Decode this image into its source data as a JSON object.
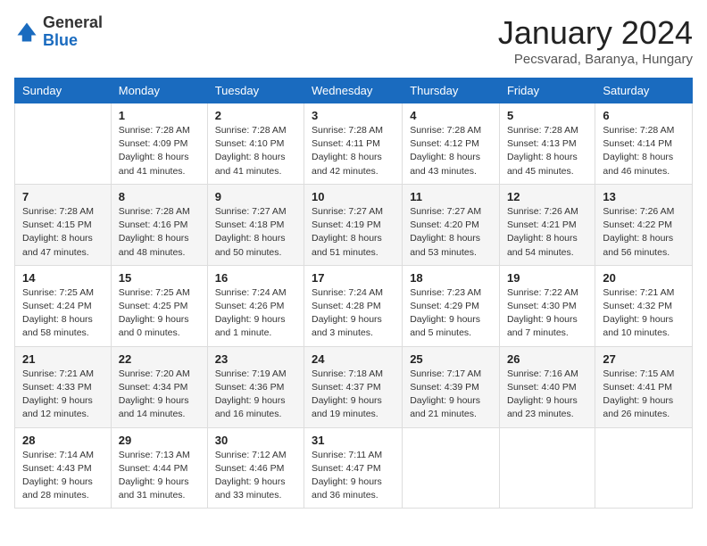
{
  "logo": {
    "general": "General",
    "blue": "Blue"
  },
  "header": {
    "month": "January 2024",
    "location": "Pecsvarad, Baranya, Hungary"
  },
  "weekdays": [
    "Sunday",
    "Monday",
    "Tuesday",
    "Wednesday",
    "Thursday",
    "Friday",
    "Saturday"
  ],
  "weeks": [
    [
      {
        "day": "",
        "info": ""
      },
      {
        "day": "1",
        "info": "Sunrise: 7:28 AM\nSunset: 4:09 PM\nDaylight: 8 hours\nand 41 minutes."
      },
      {
        "day": "2",
        "info": "Sunrise: 7:28 AM\nSunset: 4:10 PM\nDaylight: 8 hours\nand 41 minutes."
      },
      {
        "day": "3",
        "info": "Sunrise: 7:28 AM\nSunset: 4:11 PM\nDaylight: 8 hours\nand 42 minutes."
      },
      {
        "day": "4",
        "info": "Sunrise: 7:28 AM\nSunset: 4:12 PM\nDaylight: 8 hours\nand 43 minutes."
      },
      {
        "day": "5",
        "info": "Sunrise: 7:28 AM\nSunset: 4:13 PM\nDaylight: 8 hours\nand 45 minutes."
      },
      {
        "day": "6",
        "info": "Sunrise: 7:28 AM\nSunset: 4:14 PM\nDaylight: 8 hours\nand 46 minutes."
      }
    ],
    [
      {
        "day": "7",
        "info": "Sunrise: 7:28 AM\nSunset: 4:15 PM\nDaylight: 8 hours\nand 47 minutes."
      },
      {
        "day": "8",
        "info": "Sunrise: 7:28 AM\nSunset: 4:16 PM\nDaylight: 8 hours\nand 48 minutes."
      },
      {
        "day": "9",
        "info": "Sunrise: 7:27 AM\nSunset: 4:18 PM\nDaylight: 8 hours\nand 50 minutes."
      },
      {
        "day": "10",
        "info": "Sunrise: 7:27 AM\nSunset: 4:19 PM\nDaylight: 8 hours\nand 51 minutes."
      },
      {
        "day": "11",
        "info": "Sunrise: 7:27 AM\nSunset: 4:20 PM\nDaylight: 8 hours\nand 53 minutes."
      },
      {
        "day": "12",
        "info": "Sunrise: 7:26 AM\nSunset: 4:21 PM\nDaylight: 8 hours\nand 54 minutes."
      },
      {
        "day": "13",
        "info": "Sunrise: 7:26 AM\nSunset: 4:22 PM\nDaylight: 8 hours\nand 56 minutes."
      }
    ],
    [
      {
        "day": "14",
        "info": "Sunrise: 7:25 AM\nSunset: 4:24 PM\nDaylight: 8 hours\nand 58 minutes."
      },
      {
        "day": "15",
        "info": "Sunrise: 7:25 AM\nSunset: 4:25 PM\nDaylight: 9 hours\nand 0 minutes."
      },
      {
        "day": "16",
        "info": "Sunrise: 7:24 AM\nSunset: 4:26 PM\nDaylight: 9 hours\nand 1 minute."
      },
      {
        "day": "17",
        "info": "Sunrise: 7:24 AM\nSunset: 4:28 PM\nDaylight: 9 hours\nand 3 minutes."
      },
      {
        "day": "18",
        "info": "Sunrise: 7:23 AM\nSunset: 4:29 PM\nDaylight: 9 hours\nand 5 minutes."
      },
      {
        "day": "19",
        "info": "Sunrise: 7:22 AM\nSunset: 4:30 PM\nDaylight: 9 hours\nand 7 minutes."
      },
      {
        "day": "20",
        "info": "Sunrise: 7:21 AM\nSunset: 4:32 PM\nDaylight: 9 hours\nand 10 minutes."
      }
    ],
    [
      {
        "day": "21",
        "info": "Sunrise: 7:21 AM\nSunset: 4:33 PM\nDaylight: 9 hours\nand 12 minutes."
      },
      {
        "day": "22",
        "info": "Sunrise: 7:20 AM\nSunset: 4:34 PM\nDaylight: 9 hours\nand 14 minutes."
      },
      {
        "day": "23",
        "info": "Sunrise: 7:19 AM\nSunset: 4:36 PM\nDaylight: 9 hours\nand 16 minutes."
      },
      {
        "day": "24",
        "info": "Sunrise: 7:18 AM\nSunset: 4:37 PM\nDaylight: 9 hours\nand 19 minutes."
      },
      {
        "day": "25",
        "info": "Sunrise: 7:17 AM\nSunset: 4:39 PM\nDaylight: 9 hours\nand 21 minutes."
      },
      {
        "day": "26",
        "info": "Sunrise: 7:16 AM\nSunset: 4:40 PM\nDaylight: 9 hours\nand 23 minutes."
      },
      {
        "day": "27",
        "info": "Sunrise: 7:15 AM\nSunset: 4:41 PM\nDaylight: 9 hours\nand 26 minutes."
      }
    ],
    [
      {
        "day": "28",
        "info": "Sunrise: 7:14 AM\nSunset: 4:43 PM\nDaylight: 9 hours\nand 28 minutes."
      },
      {
        "day": "29",
        "info": "Sunrise: 7:13 AM\nSunset: 4:44 PM\nDaylight: 9 hours\nand 31 minutes."
      },
      {
        "day": "30",
        "info": "Sunrise: 7:12 AM\nSunset: 4:46 PM\nDaylight: 9 hours\nand 33 minutes."
      },
      {
        "day": "31",
        "info": "Sunrise: 7:11 AM\nSunset: 4:47 PM\nDaylight: 9 hours\nand 36 minutes."
      },
      {
        "day": "",
        "info": ""
      },
      {
        "day": "",
        "info": ""
      },
      {
        "day": "",
        "info": ""
      }
    ]
  ]
}
